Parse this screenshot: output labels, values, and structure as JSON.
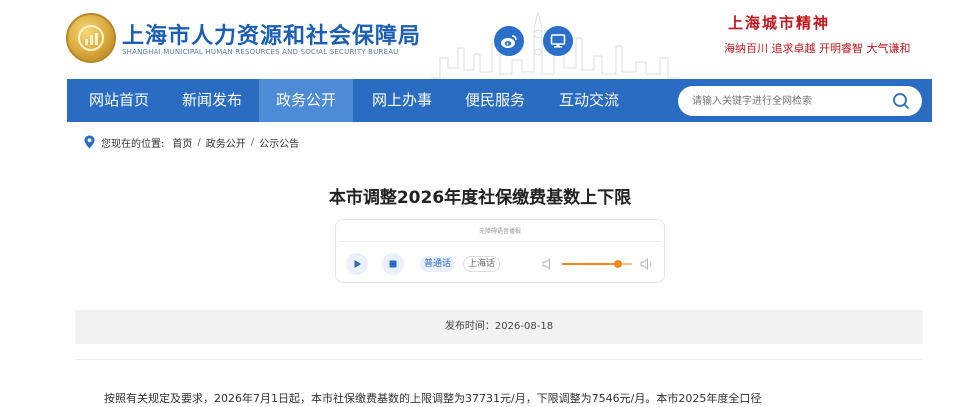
{
  "header": {
    "site_title": "上海市人力资源和社会保障局",
    "site_subtitle": "SHANGHAI MUNICIPAL HUMAN RESOURCES AND SOCIAL SECURITY BUREAU",
    "spirit_title": "上海城市精神",
    "spirit_line": "海纳百川 追求卓越 开明睿智 大气谦和",
    "social": [
      {
        "name": "weibo",
        "icon": "weibo-icon"
      },
      {
        "name": "pc",
        "icon": "monitor-icon"
      }
    ]
  },
  "nav": {
    "items": [
      {
        "label": "网站首页",
        "active": false
      },
      {
        "label": "新闻发布",
        "active": false
      },
      {
        "label": "政务公开",
        "active": true
      },
      {
        "label": "网上办事",
        "active": false
      },
      {
        "label": "便民服务",
        "active": false
      },
      {
        "label": "互动交流",
        "active": false
      }
    ],
    "search": {
      "placeholder": "请输入关键字进行全网检索",
      "icon": "search-icon"
    }
  },
  "breadcrumb": {
    "label": "您现在的位置:",
    "items": [
      "首页",
      "政务公开",
      "公示公告"
    ]
  },
  "article": {
    "title": "本市调整2026年度社保缴费基数上下限",
    "audio": {
      "hint": "无障碍语音播报",
      "languages": [
        {
          "label": "普通话",
          "active": true
        },
        {
          "label": "上海话",
          "active": false
        }
      ],
      "volume": 0.8
    },
    "publish_time": "发布时间：2026-08-18",
    "body_first_line": "按照有关规定及要求，2026年7月1日起，本市社保缴费基数的上限调整为37731元/月，下限调整为7546元/月。本市2025年度全口径"
  },
  "colors": {
    "brand_blue": "#2a6cc1",
    "nav_active": "#4d8bd6",
    "spirit_red": "#c4161c",
    "volume_orange": "#f08a1c"
  }
}
